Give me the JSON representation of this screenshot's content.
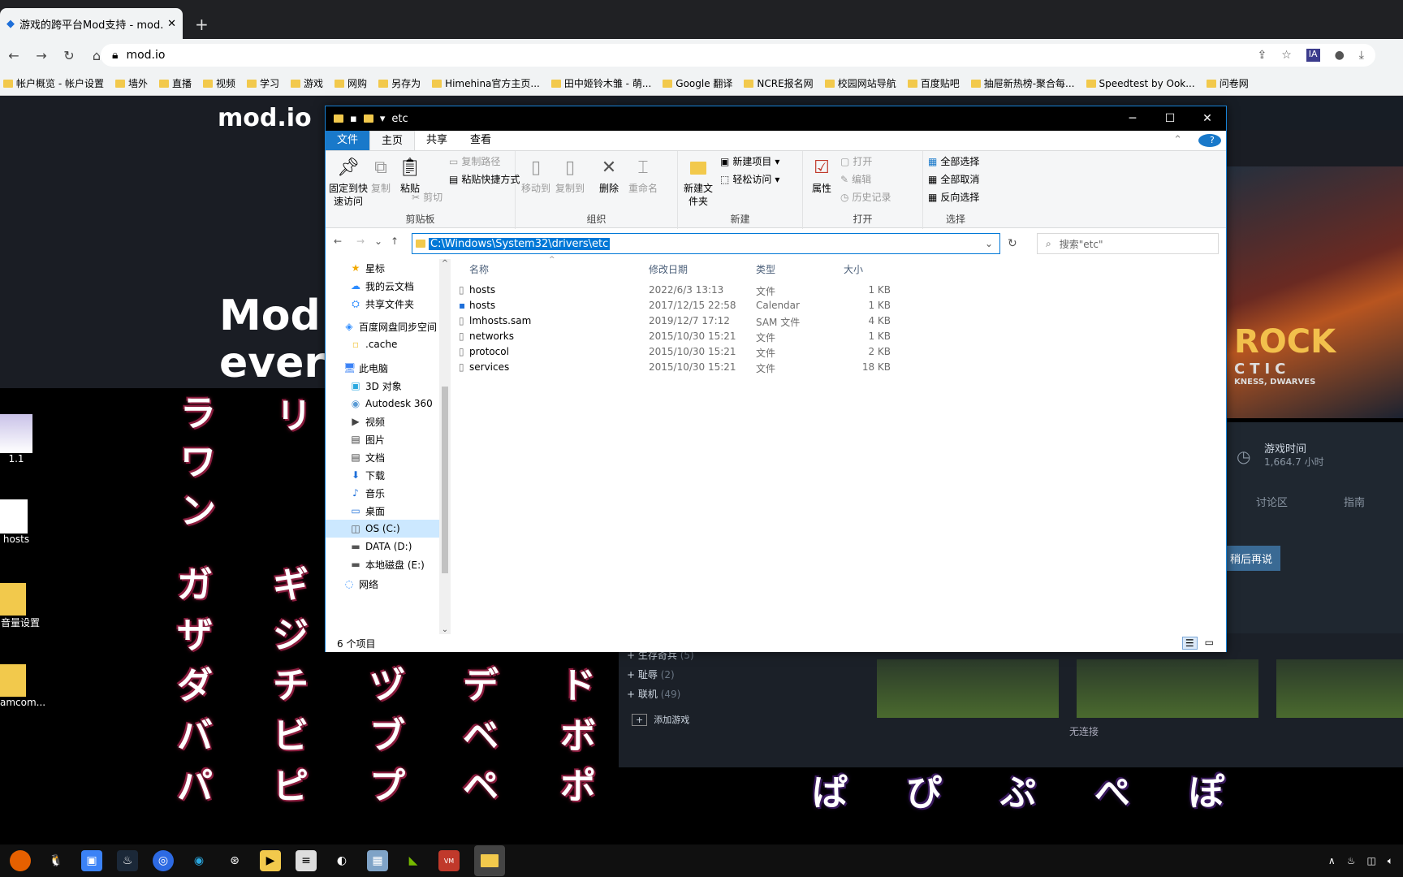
{
  "browser": {
    "tab_title": "游戏的跨平台Mod支持 - mod.io",
    "url": "mod.io",
    "new_tab": "+",
    "bookmarks": [
      "帐户概览 - 帐户设置",
      "墙外",
      "直播",
      "视频",
      "学习",
      "游戏",
      "网购",
      "另存为",
      "Himehina官方主页...",
      "田中姬铃木雏 - 萌...",
      "Google 翻译",
      "NCRE报名网",
      "校园网站导航",
      "百度贴吧",
      "抽屉新热榜-聚合每...",
      "Speedtest by Ook...",
      "问卷网"
    ]
  },
  "background": {
    "site_logo": "mod.io",
    "hero_line1": "Mod",
    "hero_line2": "every",
    "game_title_fragment": "ROCK",
    "game_sub1": "CTIC",
    "game_sub2": "KNESS, DWARVES",
    "play_time_label": "游戏时间",
    "play_time_value": "1,664.7 小时",
    "tab_discuss": "讨论区",
    "tab_guide": "指南",
    "later_btn": "稍后再说",
    "cat1": "生存奇兵",
    "cat1_count": "(5)",
    "cat2": "耻辱",
    "cat2_count": "(2)",
    "cat3": "联机",
    "cat3_count": "(49)",
    "add_game": "添加游戏",
    "no_connection": "无连接"
  },
  "desktop": {
    "icons": [
      "1.1",
      "hosts",
      "音量设置",
      "amcom..."
    ],
    "kana_cols": [
      [
        "ラ",
        "ワ",
        "ン"
      ],
      [
        "リ"
      ],
      [],
      [],
      []
    ],
    "kana_rows": [
      [
        "ガ",
        "ギ"
      ],
      [
        "ザ",
        "ジ"
      ],
      [
        "ダ",
        "チ",
        "ヅ",
        "デ",
        "ド"
      ],
      [
        "バ",
        "ビ",
        "ブ",
        "ベ",
        "ボ"
      ],
      [
        "パ",
        "ピ",
        "プ",
        "ペ",
        "ポ"
      ]
    ],
    "hira": [
      "ぱ",
      "ぴ",
      "ぷ",
      "ぺ",
      "ぽ"
    ]
  },
  "explorer": {
    "title": "etc",
    "ribbon_tabs": [
      "文件",
      "主页",
      "共享",
      "查看"
    ],
    "clipboard": {
      "pin": "固定到快速访问",
      "copy": "复制",
      "paste": "粘贴",
      "copy_path": "复制路径",
      "paste_shortcut": "粘贴快捷方式",
      "cut": "剪切",
      "label": "剪贴板"
    },
    "organize": {
      "move": "移动到",
      "copyto": "复制到",
      "delete": "删除",
      "rename": "重命名",
      "label": "组织"
    },
    "new": {
      "folder": "新建文件夹",
      "item": "新建项目",
      "easy": "轻松访问",
      "label": "新建"
    },
    "open": {
      "props": "属性",
      "open": "打开",
      "edit": "编辑",
      "history": "历史记录",
      "label": "打开"
    },
    "select": {
      "all": "全部选择",
      "none": "全部取消",
      "invert": "反向选择",
      "label": "选择"
    },
    "address": "C:\\Windows\\System32\\drivers\\etc",
    "search_placeholder": "搜索\"etc\"",
    "nav": [
      "星标",
      "我的云文档",
      "共享文件夹",
      "百度网盘同步空间",
      ".cache",
      "此电脑",
      "3D 对象",
      "Autodesk 360",
      "视频",
      "图片",
      "文档",
      "下载",
      "音乐",
      "桌面",
      "OS (C:)",
      "DATA (D:)",
      "本地磁盘 (E:)",
      "网络"
    ],
    "columns": {
      "name": "名称",
      "date": "修改日期",
      "type": "类型",
      "size": "大小"
    },
    "files": [
      {
        "name": "hosts",
        "date": "2022/6/3 13:13",
        "type": "文件",
        "size": "1 KB"
      },
      {
        "name": "hosts",
        "date": "2017/12/15 22:58",
        "type": "Calendar",
        "size": "1 KB"
      },
      {
        "name": "lmhosts.sam",
        "date": "2019/12/7 17:12",
        "type": "SAM 文件",
        "size": "4 KB"
      },
      {
        "name": "networks",
        "date": "2015/10/30 15:21",
        "type": "文件",
        "size": "1 KB"
      },
      {
        "name": "protocol",
        "date": "2015/10/30 15:21",
        "type": "文件",
        "size": "2 KB"
      },
      {
        "name": "services",
        "date": "2015/10/30 15:21",
        "type": "文件",
        "size": "18 KB"
      }
    ],
    "status": "6 个项目"
  },
  "colors": {
    "accent": "#0078d7",
    "kana_outline": "#8b1e3f"
  }
}
